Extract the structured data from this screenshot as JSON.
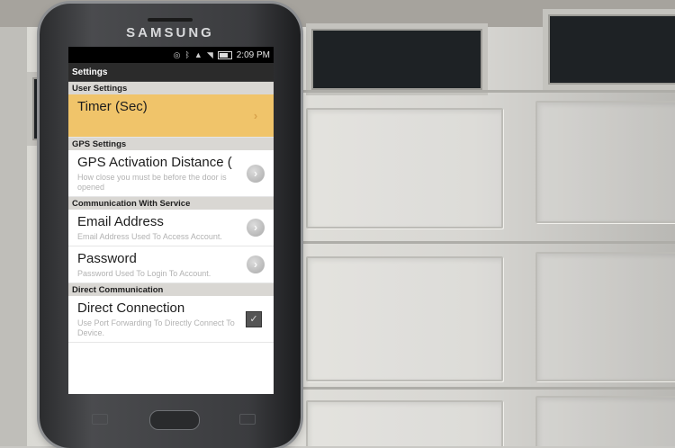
{
  "phone": {
    "brand": "SAMSUNG"
  },
  "status_bar": {
    "time": "2:09 PM"
  },
  "screen": {
    "title": "Settings",
    "sections": [
      {
        "header": "User Settings",
        "items": [
          {
            "title": "Timer (Sec)",
            "summary": "",
            "control": "chevron-icon"
          }
        ]
      },
      {
        "header": "GPS Settings",
        "items": [
          {
            "title": "GPS Activation Distance (",
            "summary": "How close you must be before the door is opened",
            "control": "chevron-icon"
          }
        ]
      },
      {
        "header": "Communication With Service",
        "items": [
          {
            "title": "Email Address",
            "summary": "Email Address Used To Access Account.",
            "control": "chevron-icon"
          },
          {
            "title": "Password",
            "summary": "Password Used To Login To Account.",
            "control": "chevron-icon"
          }
        ]
      },
      {
        "header": "Direct Communication",
        "items": [
          {
            "title": "Direct Connection",
            "summary": "Use Port Forwarding To Directly Connect To Device.",
            "control": "checkbox-icon"
          }
        ]
      }
    ]
  }
}
